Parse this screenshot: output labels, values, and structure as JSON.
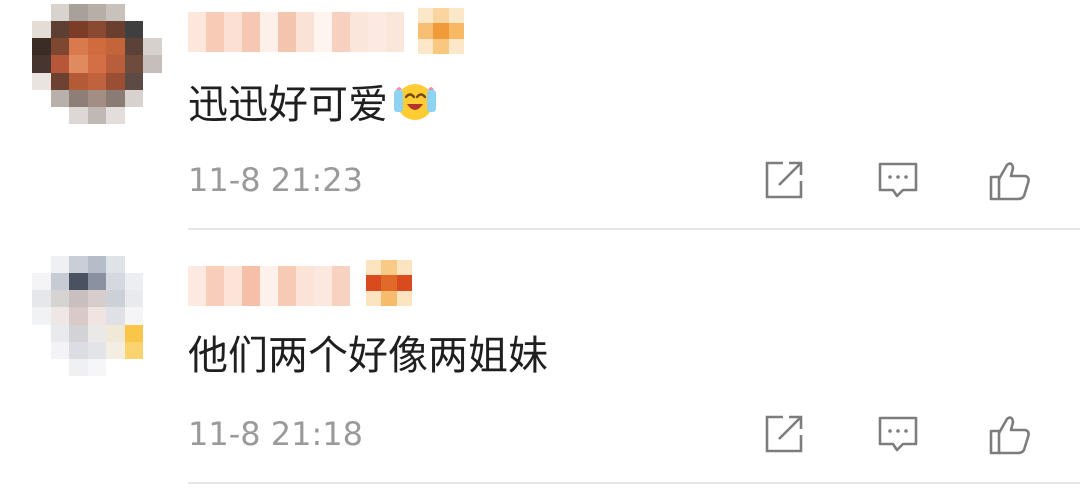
{
  "comments": [
    {
      "text": "迅迅好可爱",
      "emoji": "happy-face-with-tears-emoji",
      "timestamp": "11-8 21:23"
    },
    {
      "text": "他们两个好像两姐妹",
      "timestamp": "11-8 21:18"
    }
  ],
  "actions": {
    "share": "share-icon",
    "reply": "comment-icon",
    "like": "like-icon"
  },
  "colors": {
    "text": "#1f1f1f",
    "timestamp": "#9a9a9a",
    "icon": "#7d7d7d",
    "divider": "#e6e6e6"
  }
}
